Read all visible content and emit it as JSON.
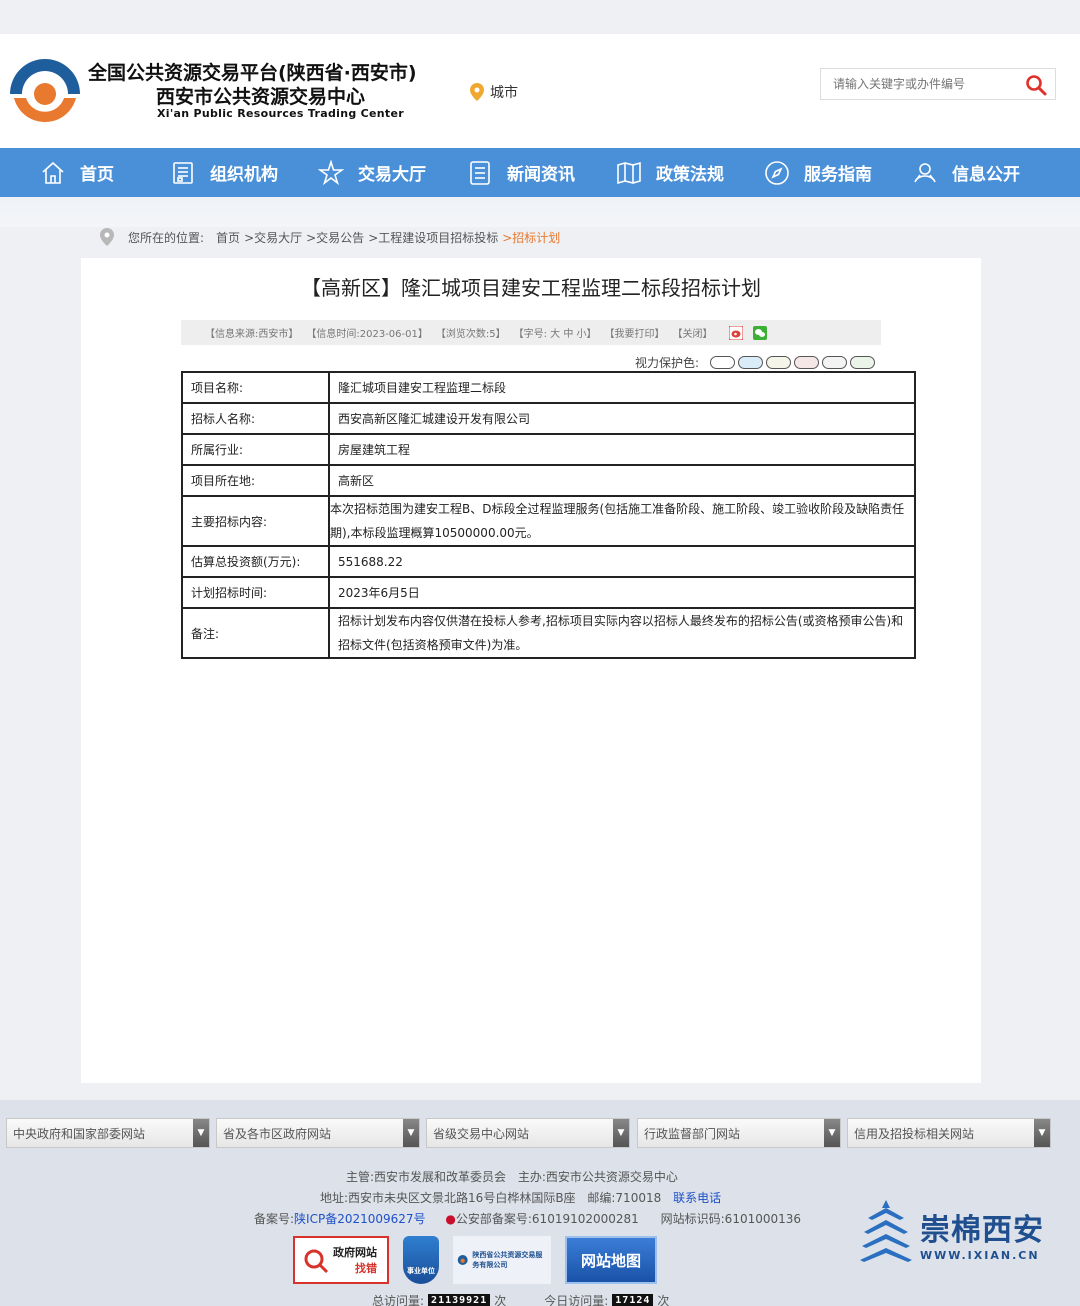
{
  "header": {
    "title_line1": "全国公共资源交易平台(陕西省·西安市)",
    "title_line2": "西安市公共资源交易中心",
    "title_en": "Xi'an Public Resources Trading Center",
    "city_label": "城市",
    "search_placeholder": "请输入关键字或办件编号"
  },
  "nav": [
    {
      "label": "首页",
      "icon": "home-icon"
    },
    {
      "label": "组织机构",
      "icon": "org-icon"
    },
    {
      "label": "交易大厅",
      "icon": "star-icon"
    },
    {
      "label": "新闻资讯",
      "icon": "news-icon"
    },
    {
      "label": "政策法规",
      "icon": "book-icon"
    },
    {
      "label": "服务指南",
      "icon": "compass-icon"
    },
    {
      "label": "信息公开",
      "icon": "info-icon"
    }
  ],
  "breadcrumb": {
    "prefix": "您所在的位置:",
    "items": [
      "首页",
      ">交易大厅",
      ">交易公告",
      ">工程建设项目招标投标",
      ">招标计划"
    ]
  },
  "article": {
    "title": "【高新区】隆汇城项目建安工程监理二标段招标计划",
    "meta": {
      "source": "【信息来源:西安市】",
      "time": "【信息时间:2023-06-01】",
      "views": "【浏览次数:5】",
      "font": "【字号: 大 中 小】",
      "print": "【我要打印】",
      "close": "【关闭】"
    },
    "eye_label": "视力保护色:",
    "eye_colors": [
      "#ffffff",
      "#d9ecf8",
      "#f4f4e8",
      "#f5e7e6",
      "#f3f3f3",
      "#eaf4e8"
    ],
    "rows": [
      {
        "k": "项目名称:",
        "v": "隆汇城项目建安工程监理二标段"
      },
      {
        "k": "招标人名称:",
        "v": "西安高新区隆汇城建设开发有限公司"
      },
      {
        "k": "所属行业:",
        "v": "房屋建筑工程"
      },
      {
        "k": "项目所在地:",
        "v": "高新区"
      },
      {
        "k": "主要招标内容:",
        "v": "本次招标范围为建安工程B、D标段全过程监理服务(包括施工准备阶段、施工阶段、竣工验收阶段及缺陷责任期),本标段监理概算10500000.00元。"
      },
      {
        "k": "估算总投资额(万元):",
        "v": "551688.22"
      },
      {
        "k": "计划招标时间:",
        "v": "2023年6月5日"
      },
      {
        "k": "备注:",
        "v": "招标计划发布内容仅供潜在投标人参考,招标项目实际内容以招标人最终发布的招标公告(或资格预审公告)和招标文件(包括资格预审文件)为准。"
      }
    ]
  },
  "footer": {
    "selects": [
      "中央政府和国家部委网站",
      "省及各市区政府网站",
      "省级交易中心网站",
      "行政监督部门网站",
      "信用及招投标相关网站"
    ],
    "sponsor": "主管:西安市发展和改革委员会",
    "host": "主办:西安市公共资源交易中心",
    "address": "地址:西安市未央区文景北路16号白桦林国际B座",
    "postcode": "邮编:710018",
    "contact": "联系电话",
    "icp_label": "备案号:",
    "icp": "陕ICP备2021009627号",
    "police": "公安部备案号:61019102000281",
    "site_id": "网站标识码:6101000136",
    "badge_gov": "政府网站",
    "badge_gov2": "找错",
    "badge_unit": "事业单位",
    "badge_company": "陕西省公共资源交易服务有限公司",
    "badge_map": "网站地图",
    "total_label": "总访问量:",
    "total_value": "21139921",
    "today_label": "今日访问量:",
    "today_value": "17124",
    "unit": "次",
    "brand_cn": "崇棉西安",
    "brand_en": "WWW.IXIAN.CN"
  }
}
